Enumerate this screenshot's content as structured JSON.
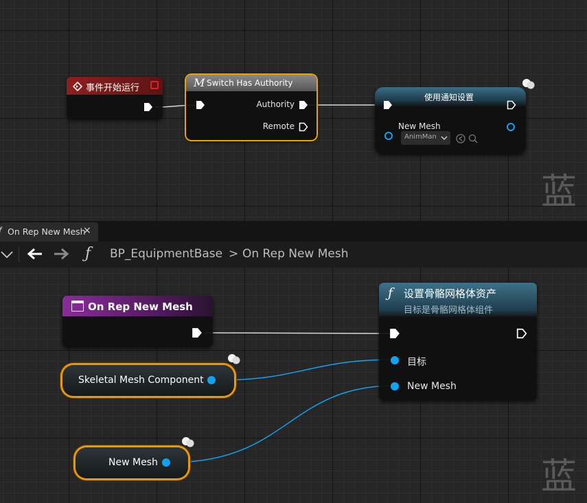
{
  "top_graph": {
    "event_node": {
      "title": "事件开始运行"
    },
    "switch_node": {
      "macro_glyph": "M",
      "title": "Switch Has Authority",
      "pins": {
        "authority": "Authority",
        "remote": "Remote"
      }
    },
    "notify_node": {
      "title": "使用通知设置",
      "new_mesh_label": "New Mesh",
      "dropdown_value": "AnimMan"
    },
    "watermark": "蓝"
  },
  "tab_bar": {
    "tab_icon": "f",
    "tab_label": "On Rep New Mesh",
    "close": "×"
  },
  "toolbar": {
    "func_icon": "ƒ",
    "breadcrumb_class": "BP_EquipmentBase",
    "breadcrumb_sep": ">",
    "breadcrumb_func": "On Rep New Mesh"
  },
  "bottom_graph": {
    "event_node": {
      "title": "On Rep New Mesh"
    },
    "set_node": {
      "func_icon": "ƒ",
      "title": "设置骨骼网格体资产",
      "subtitle": "目标是骨骼网格体组件",
      "pin_target": "目标",
      "pin_new_mesh": "New Mesh"
    },
    "var_skeletal": {
      "label": "Skeletal Mesh Component"
    },
    "var_new_mesh": {
      "label": "New Mesh"
    },
    "watermark": "蓝"
  },
  "colors": {
    "selection": "#f0a000",
    "data_pin": "#0ea4f2",
    "event_header": "#8b1c1c",
    "func_header": "#2d5a73",
    "rep_event_header": "#7a2a8a"
  }
}
